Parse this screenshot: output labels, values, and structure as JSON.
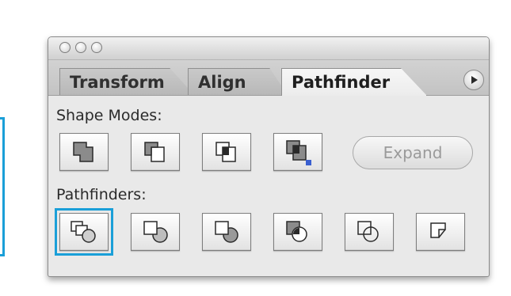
{
  "window": {
    "controls": [
      "close",
      "minimize",
      "zoom"
    ]
  },
  "tabs": [
    {
      "label": "Transform",
      "active": false
    },
    {
      "label": "Align",
      "active": false
    },
    {
      "label": "Pathfinder",
      "active": true
    }
  ],
  "shape_modes": {
    "label": "Shape Modes:",
    "buttons": [
      {
        "icon": "add-to-shape-area-icon"
      },
      {
        "icon": "subtract-from-shape-area-icon"
      },
      {
        "icon": "intersect-shape-areas-icon"
      },
      {
        "icon": "exclude-overlapping-shape-areas-icon"
      }
    ],
    "expand_label": "Expand"
  },
  "pathfinders": {
    "label": "Pathfinders:",
    "buttons": [
      {
        "icon": "divide-icon",
        "selected": true
      },
      {
        "icon": "trim-icon",
        "selected": false
      },
      {
        "icon": "merge-icon",
        "selected": false
      },
      {
        "icon": "crop-icon",
        "selected": false
      },
      {
        "icon": "outline-icon",
        "selected": false
      },
      {
        "icon": "minus-back-icon",
        "selected": false
      }
    ]
  },
  "colors": {
    "highlight": "#1a9fd8",
    "accent_square": "#3a5fd0"
  }
}
